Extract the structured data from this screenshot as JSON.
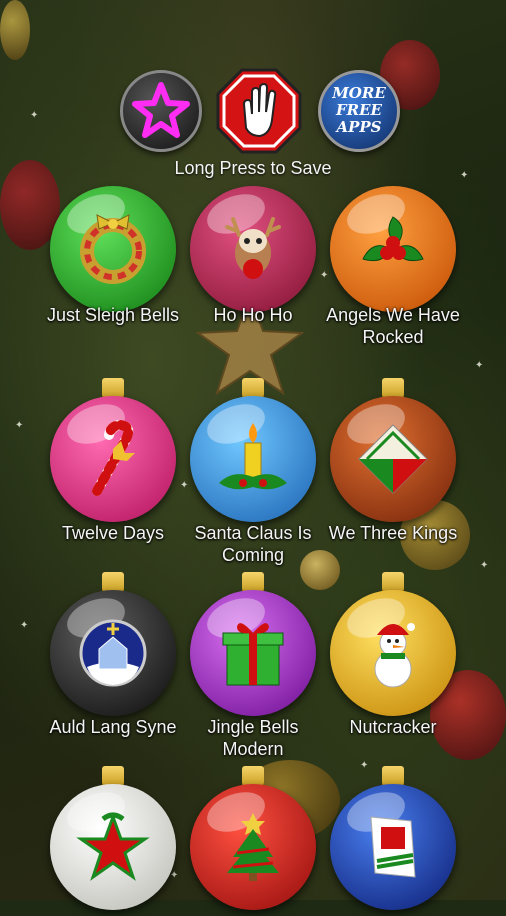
{
  "header": {
    "save_hint": "Long Press to Save"
  },
  "top_buttons": [
    {
      "icon": "star-icon",
      "color": "#d40fd8"
    },
    {
      "icon": "stop-hand-icon",
      "color": "#d41414"
    },
    {
      "icon": "more-free-apps-icon",
      "label_lines": [
        "MORE",
        "FREE",
        "APPS"
      ],
      "color": "#1e4fa0"
    }
  ],
  "songs": [
    {
      "label": "Just Sleigh Bells",
      "icon": "wreath-icon",
      "color": "#20b020"
    },
    {
      "label": "Ho Ho Ho",
      "icon": "reindeer-icon",
      "color": "#c01848"
    },
    {
      "label": "Angels We Have Rocked",
      "icon": "holly-icon",
      "color": "#f07010"
    },
    {
      "label": "Twelve Days",
      "icon": "candy-cane-icon",
      "color": "#e8207c"
    },
    {
      "label": "Santa Claus Is Coming",
      "icon": "candle-icon",
      "color": "#2a9ae8"
    },
    {
      "label": "We Three Kings",
      "icon": "envelope-icon",
      "color": "#b04a0c"
    },
    {
      "label": "Auld Lang Syne",
      "icon": "snow-globe-icon",
      "color": "#1a1a1a"
    },
    {
      "label": "Jingle Bells Modern",
      "icon": "gift-icon",
      "color": "#a020c0"
    },
    {
      "label": "Nutcracker",
      "icon": "snowman-icon",
      "color": "#f4c010"
    },
    {
      "label": "",
      "icon": "star-ornament-icon",
      "color": "#f0f0ec"
    },
    {
      "label": "",
      "icon": "christmas-tree-icon",
      "color": "#d01010"
    },
    {
      "label": "",
      "icon": "card-icon",
      "color": "#1a40b0"
    }
  ]
}
